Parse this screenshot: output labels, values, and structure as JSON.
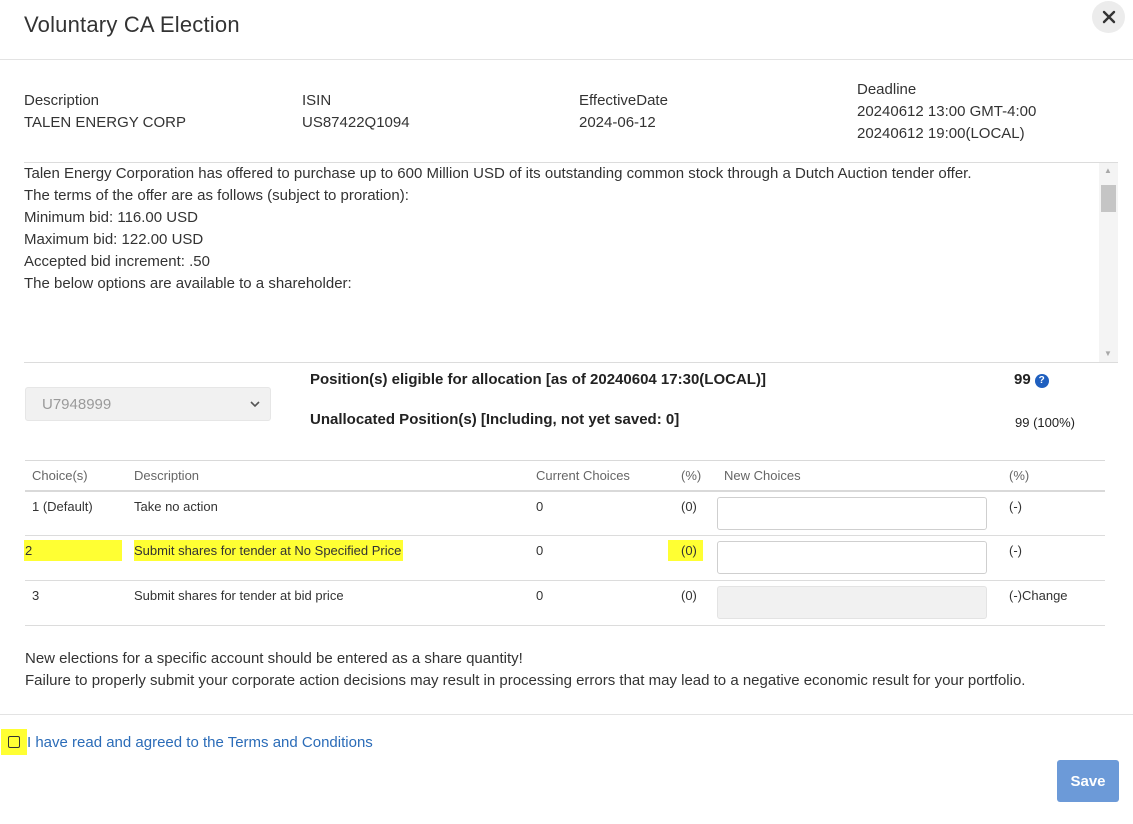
{
  "dialog": {
    "title": "Voluntary CA Election"
  },
  "meta": {
    "description_label": "Description",
    "description_value": "TALEN ENERGY CORP",
    "isin_label": "ISIN",
    "isin_value": "US87422Q1094",
    "effective_label": "EffectiveDate",
    "effective_value": "2024-06-12",
    "deadline_label": "Deadline",
    "deadline_value_1": "20240612 13:00 GMT-4:00",
    "deadline_value_2": "20240612 19:00(LOCAL)"
  },
  "offer_text": [
    "Talen Energy Corporation has offered to purchase up to 600 Million USD of its outstanding common stock through a Dutch Auction tender offer.",
    "",
    "The terms of the offer are as follows (subject to proration):",
    "",
    "Minimum bid: 116.00 USD",
    "Maximum bid: 122.00 USD",
    "Accepted bid increment: .50",
    "",
    "The below options are available to a shareholder:"
  ],
  "account": {
    "selected": "U7948999"
  },
  "positions": {
    "eligible_label": "Position(s) eligible for allocation [as of   20240604 17:30(LOCAL)]",
    "eligible_value": "99",
    "unallocated_label": "Unallocated Position(s) [Including, not yet saved: 0]",
    "unallocated_value": "99 (100%)"
  },
  "table": {
    "headers": [
      "Choice(s)",
      "Description",
      "Current Choices",
      "(%)",
      "New Choices",
      "(%)"
    ],
    "rows": [
      {
        "choice": "1 (Default)",
        "description": "Take no action",
        "current": "0",
        "pct": "(0)",
        "new_pct": "(-)",
        "new_enabled": true,
        "highlight": false
      },
      {
        "choice": "2",
        "description": "Submit shares for tender at No Specified Price",
        "current": "0",
        "pct": "(0)",
        "new_pct": "(-)",
        "new_enabled": true,
        "highlight": true
      },
      {
        "choice": "3",
        "description": "Submit shares for tender at bid price",
        "current": "0",
        "pct": "(0)",
        "new_pct": "(-)Change",
        "new_enabled": false,
        "highlight": false
      }
    ]
  },
  "notes": {
    "line1": "New elections for a specific account should be entered as a share quantity!",
    "line2": "Failure to properly submit your corporate action decisions may result in processing errors that may lead to a negative economic result for your portfolio."
  },
  "terms": {
    "label": "I have read and agreed to the Terms and Conditions"
  },
  "actions": {
    "save_label": "Save"
  },
  "colors": {
    "highlight": "#ffff33",
    "link": "#2b6cb8",
    "save_button": "#6c9ad8"
  },
  "icons": {
    "close": "close-icon",
    "dropdown": "chevron-down-icon",
    "info": "info-icon"
  }
}
